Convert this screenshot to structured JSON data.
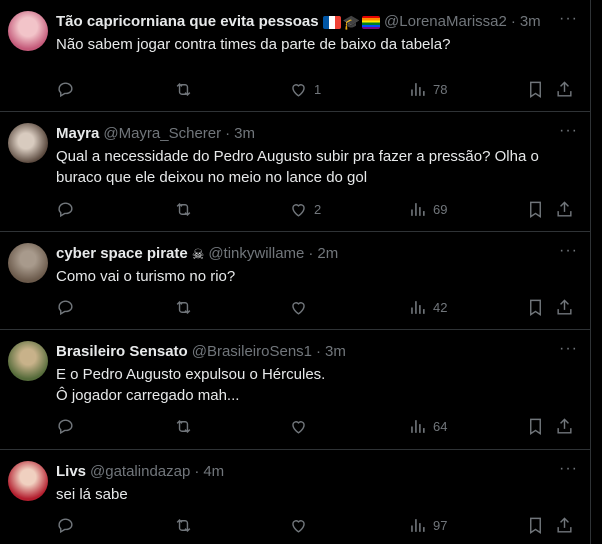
{
  "tweets": [
    {
      "name": "Tão capricorniana que evita pessoas",
      "handle": "@LorenaMarissa2",
      "sep": "·",
      "time": "3m",
      "text": "Não sabem jogar contra times da parte de baixo da tabela?",
      "likes": "1",
      "views": "78",
      "avatar_colors": [
        "#c45a7a",
        "#f2c4c9"
      ]
    },
    {
      "name": "Mayra",
      "handle": "@Mayra_Scherer",
      "sep": "·",
      "time": "3m",
      "text": "Qual a necessidade do Pedro Augusto subir pra fazer a pressão? Olha o buraco que ele deixou no meio no lance do gol",
      "likes": "2",
      "views": "69",
      "avatar_colors": [
        "#5b4a3f",
        "#d8cbbf"
      ]
    },
    {
      "name": "cyber space pirate",
      "handle": "@tinkywillame",
      "sep": "·",
      "time": "2m",
      "text": "Como vai o turismo no rio?",
      "likes": "",
      "views": "42",
      "avatar_colors": [
        "#6b5a4b",
        "#a89a8c"
      ]
    },
    {
      "name": "Brasileiro Sensato",
      "handle": "@BrasileiroSens1",
      "sep": "·",
      "time": "3m",
      "text": "E o Pedro Augusto expulsou o Hércules.\nÔ jogador carregado mah...",
      "likes": "",
      "views": "64",
      "avatar_colors": [
        "#556b3a",
        "#c8b28a"
      ]
    },
    {
      "name": "Livs",
      "handle": "@gatalindazap",
      "sep": "·",
      "time": "4m",
      "text": "sei lá sabe",
      "likes": "",
      "views": "97",
      "avatar_colors": [
        "#b31e2e",
        "#f0d0c0"
      ]
    }
  ],
  "more_label": "···",
  "emoji_flags": {
    "tweet0": [
      "flag-france",
      "graduation-cap",
      "rainbow-flag"
    ],
    "tweet2": [
      "skull-crossbones"
    ]
  }
}
